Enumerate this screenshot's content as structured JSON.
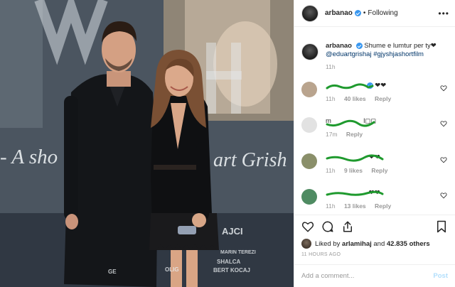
{
  "post": {
    "username": "arbanao",
    "follow_dot": "•",
    "follow_status": "Following",
    "more_label": "•••"
  },
  "photo": {
    "backdrop_text": "- A sho",
    "backdrop_text2": "art Grish",
    "credits": [
      "AJCI",
      "MARIN TEREZI",
      "SHALCA",
      "OLIG",
      "BERT KOCAJ",
      "GE"
    ]
  },
  "caption": {
    "username": "arbanao",
    "text": "Shume e lumtur per ty❤",
    "mention": "@eduartgrishaj",
    "hashtag": "#gjyshjashortfilm",
    "time": "11h"
  },
  "comments": [
    {
      "text_suffix": "❤❤",
      "time": "11h",
      "likes": "40 likes",
      "reply": "Reply",
      "verified": true,
      "avatar_color": "#b9a48e"
    },
    {
      "text_prefix": "m",
      "text_suffix": "l◻◻",
      "time": "17m",
      "likes": "",
      "reply": "Reply",
      "verified": false,
      "avatar_color": "#e2e2e2"
    },
    {
      "text_suffix": "❤❤",
      "time": "11h",
      "likes": "9 likes",
      "reply": "Reply",
      "verified": false,
      "avatar_color": "#8a8f6a"
    },
    {
      "text_suffix": "❤❤",
      "time": "11h",
      "likes": "13 likes",
      "reply": "Reply",
      "verified": false,
      "avatar_color": "#4f8b62"
    }
  ],
  "actions": {
    "liked_prefix": "Liked by",
    "liked_user": "arlamihaj",
    "liked_and": "and",
    "liked_count": "42.835 others",
    "time_ago": "11 HOURS AGO",
    "comment_placeholder": "Add a comment...",
    "post_label": "Post"
  },
  "icons": [
    "heart-icon",
    "comment-icon",
    "share-icon",
    "bookmark-icon",
    "verified-icon",
    "more-icon"
  ],
  "colors": {
    "link": "#003569",
    "verified": "#3897f0",
    "scribble": "#1f9a2e",
    "muted": "#999999",
    "post_disabled": "#b2dffc"
  }
}
